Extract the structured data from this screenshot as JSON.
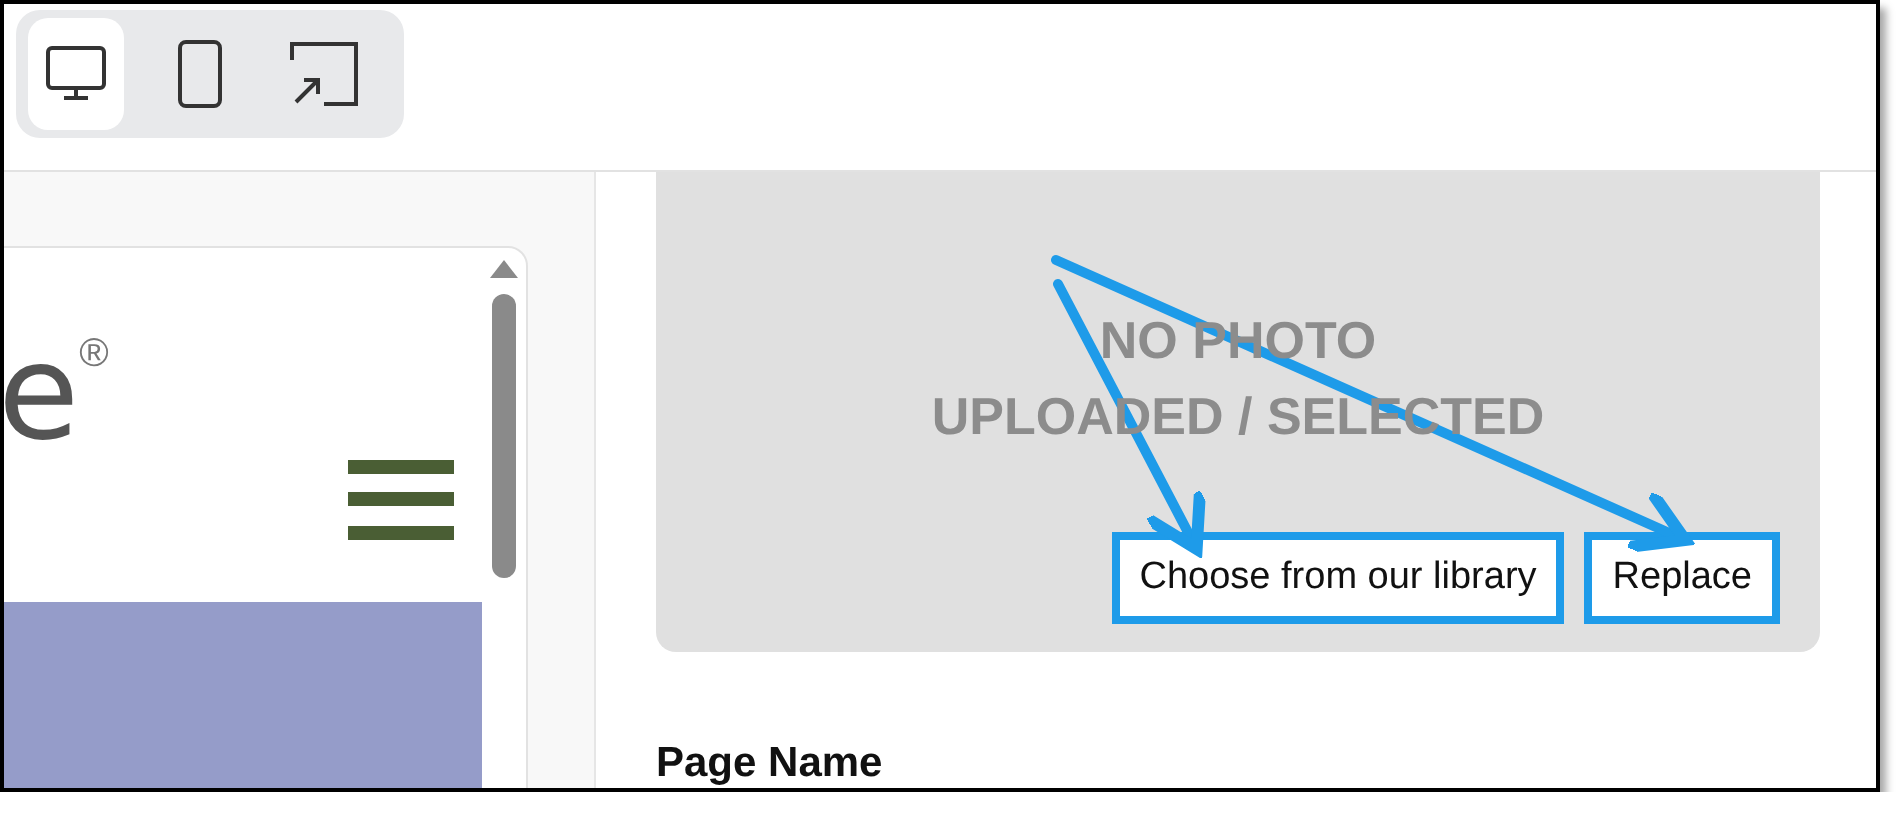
{
  "device_tabs": [
    {
      "kind": "desktop",
      "selected": true
    },
    {
      "kind": "mobile",
      "selected": false
    },
    {
      "kind": "popout",
      "selected": false
    }
  ],
  "preview": {
    "logo_text": "e",
    "logo_mark": "®"
  },
  "photo": {
    "placeholder_lines": [
      "NO PHOTO",
      "UPLOADED / SELECTED"
    ],
    "buttons": [
      {
        "label": "Choose from our library",
        "highlighted": true
      },
      {
        "label": "Replace",
        "highlighted": true
      }
    ]
  },
  "section_heading": "Page Name"
}
